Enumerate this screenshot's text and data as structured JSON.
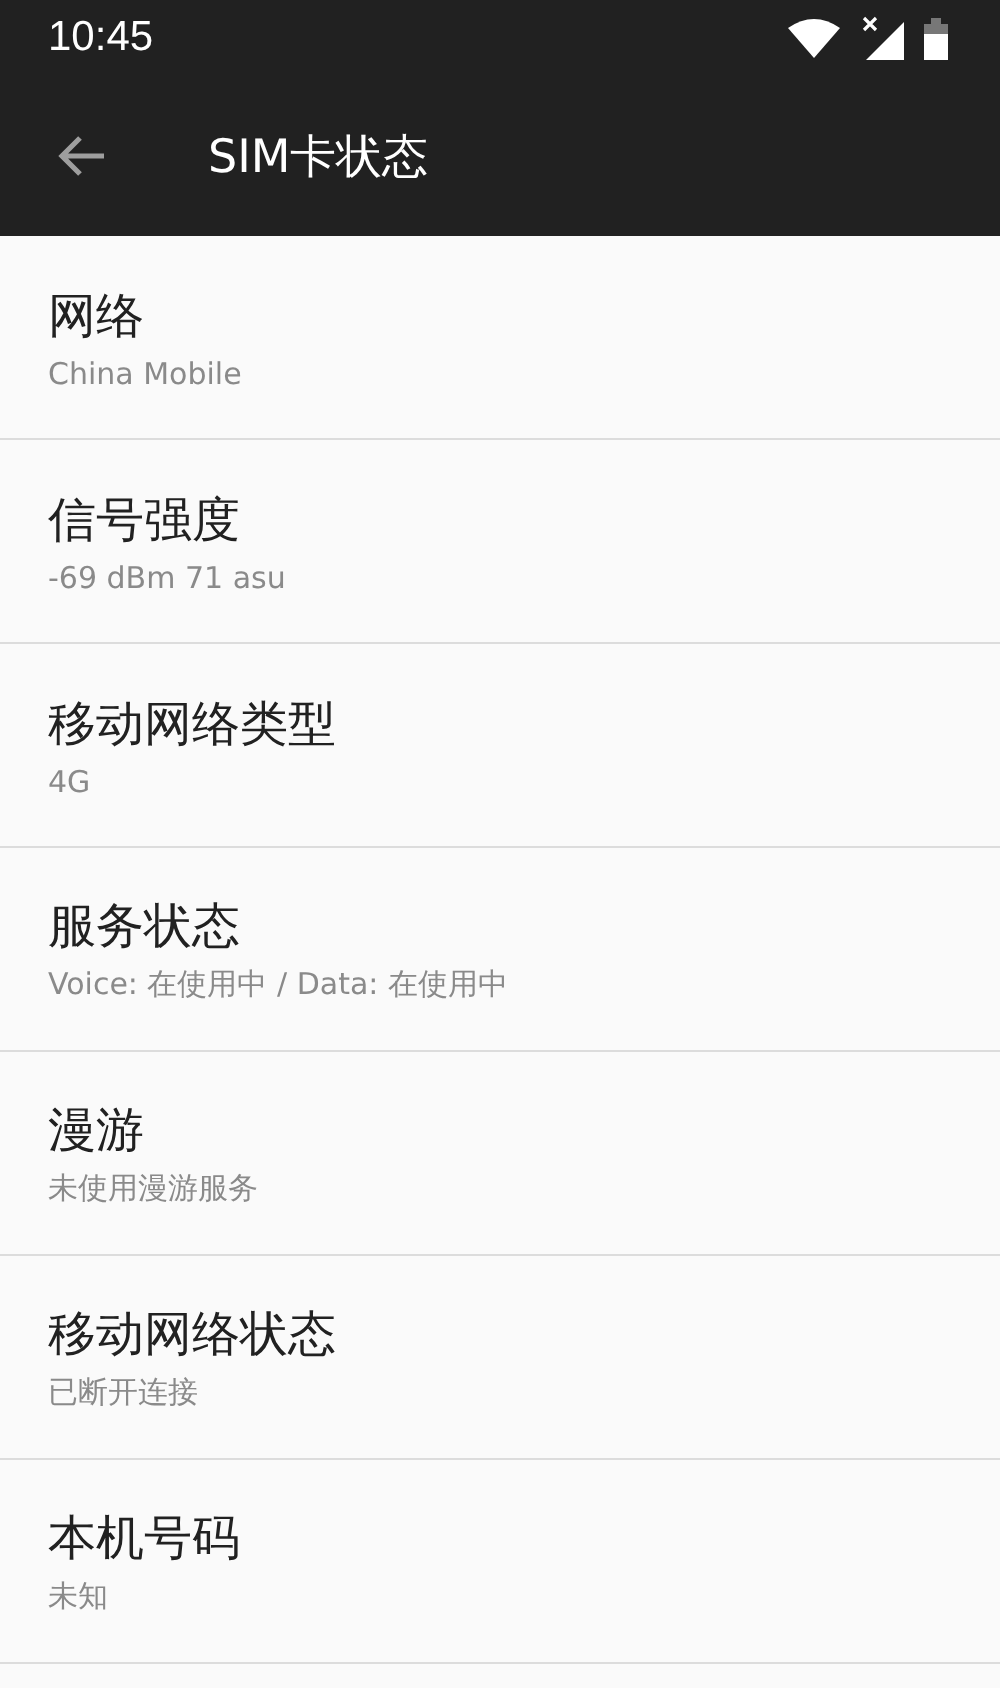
{
  "status_bar": {
    "time": "10:45"
  },
  "app_bar": {
    "title": "SIM卡状态"
  },
  "items": [
    {
      "title": "网络",
      "summary": "China Mobile"
    },
    {
      "title": "信号强度",
      "summary": "-69 dBm 71 asu"
    },
    {
      "title": "移动网络类型",
      "summary": "4G"
    },
    {
      "title": "服务状态",
      "summary": "Voice: 在使用中 / Data: 在使用中"
    },
    {
      "title": "漫游",
      "summary": "未使用漫游服务"
    },
    {
      "title": "移动网络状态",
      "summary": "已断开连接"
    },
    {
      "title": "本机号码",
      "summary": "未知"
    }
  ]
}
